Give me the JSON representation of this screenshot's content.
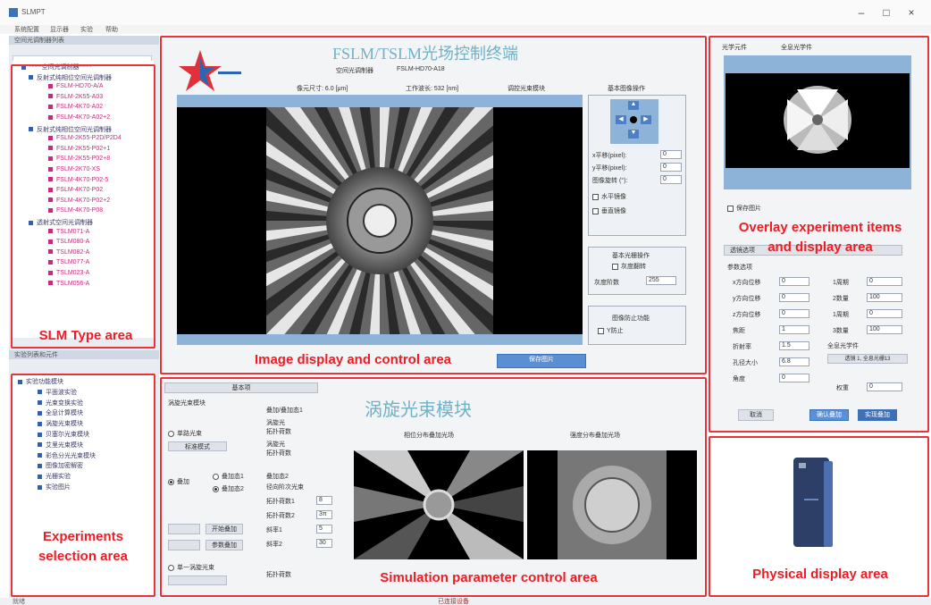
{
  "window": {
    "title": "SLMPT",
    "minimize": "–",
    "maximize": "□",
    "close": "×"
  },
  "menubar": [
    "系统配置",
    "显示器",
    "实验",
    "帮助"
  ],
  "slm_pane": {
    "header": "空间光调制器列表",
    "root": "*****空间光调制器*****",
    "groups": [
      {
        "name": "反射式纯相位空间光调制器",
        "items": [
          "FSLM-HD70-A/A",
          "FSLM-2K55-A03",
          "FSLM-4K70-A02",
          "FSLM-4K70-A02+2"
        ]
      },
      {
        "name": "反射式纯相位空间光调制器",
        "items": [
          "FSLM-2K55-P2D/P2D4",
          "FSLM-2K55-P02+1",
          "FSLM-2K55-P02+8",
          "FSLM-2K70-XS",
          "FSLM-4K70-P02-5",
          "FSLM-4K70-P02",
          "FSLM-4K70-P02+2",
          "FSLM-4K70-P08"
        ]
      },
      {
        "name": "透射式空间光调制器",
        "items": [
          "TSLM071-A",
          "TSLM080-A",
          "TSLM082-A",
          "TSLM077-A",
          "TSLM023-A",
          "TSLM056-A"
        ]
      }
    ]
  },
  "exp_pane": {
    "header": "实验列表和元件",
    "root": "实验功能模块",
    "items": [
      "平面波实验",
      "光束变换实验",
      "全息计算模块",
      "涡旋光束模块",
      "贝塞尔光束模块",
      "艾里光束模块",
      "彩色分光光束模块",
      "图像加密解密",
      "光栅实验",
      "实验图片"
    ]
  },
  "image_area": {
    "title": "FSLM/TSLM光场控制终端",
    "model_label": "空间光调制器",
    "model_value": "FSLM-HD70-A18",
    "pixel_label": "像元尺寸: 6.0 [μm]",
    "wavelength_label": "工作波长: 532 [nm]",
    "mode_label": "调控光束模块",
    "save_button": "保存图片",
    "basic_ops_title": "基本图像操作",
    "x_shift": "x平移(pixel):",
    "x_shift_value": "0",
    "y_shift": "y平移(pixel):",
    "y_shift_value": "0",
    "rotate": "图像旋转 (°):",
    "rotate_value": "0",
    "hflip": "水平镜像",
    "vflip": "垂直镜像",
    "basic_light": "基本光栅操作",
    "gray_invert": "灰度翻转",
    "gray_depth_label": "灰度阶数",
    "gray_depth_value": "255",
    "lock_title": "图像防止功能",
    "lock_check": "Y防止"
  },
  "sim_area": {
    "tab": "基本项",
    "vortex_label": "涡旋光束模块",
    "radio_single": "单路光束",
    "radio_overlay": "叠加",
    "radio_overlay_a": "叠加态1",
    "radio_overlay_b": "叠加态2",
    "radio_one": "单一涡旋光束",
    "mode_combo": "标准模式",
    "overlay_label": "叠加/叠加态1",
    "vortex_a": "涡旋光",
    "topo_a": "拓扑荷数",
    "vortex_b": "涡旋光",
    "topo_b": "拓扑荷数",
    "overlay2_label": "叠加态2",
    "radial_label": "径向阶次光束",
    "topo_1": "拓扑荷数1",
    "topo_1_value": "8",
    "topo_2": "拓扑荷数2",
    "topo_2_value": "3π",
    "slope_1": "斜率1",
    "slope_1_value": "5",
    "slope_2": "斜率2",
    "slope_2_value": "30",
    "topo_bottom": "拓扑荷数",
    "btn_start": "开始叠加",
    "btn_param": "参数叠加",
    "module_title": "涡旋光束模块",
    "left_caption": "相位分布叠加光场",
    "right_caption": "强度分布叠加光场"
  },
  "overlay_area": {
    "tab1": "光学元件",
    "tab2": "全息光学件",
    "save_check": "保存图片",
    "combo": "透镜选项",
    "param_title": "参数选项",
    "params_left": [
      "x方向位移",
      "y方向位移",
      "z方向位移",
      "焦距",
      "折射率",
      "孔径大小",
      "角度"
    ],
    "params_left_values": [
      "0",
      "0",
      "0",
      "1",
      "1.5",
      "6.8",
      "0"
    ],
    "params_right": [
      "1周期",
      "2数量",
      "1周期",
      "3数量"
    ],
    "params_right_values": [
      "0",
      "100",
      "0",
      "100"
    ],
    "extra_label": "全息光学件",
    "extra_combo": "透镜 1, 全息光栅13",
    "weight_label": "权重",
    "weight_value": "0",
    "btn_cancel": "取消",
    "btn_confirm": "确认叠加",
    "btn_ok": "实现叠加"
  },
  "labels": {
    "slm": "SLM Type area",
    "experiments": "Experiments\nselection area",
    "image": "Image display and control area",
    "sim": "Simulation parameter control area",
    "overlay": "Overlay experiment items\nand display area",
    "physical": "Physical display area"
  },
  "statusbar": {
    "left": "就绪",
    "center": "已连接设备"
  },
  "colors": {
    "red": "#e8333a",
    "panel_blue": "#9bb8d8",
    "device_blue": "#2d3f66"
  }
}
